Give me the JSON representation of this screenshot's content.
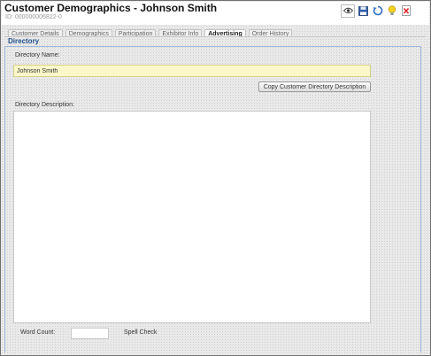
{
  "header": {
    "title": "Customer Demographics - Johnson Smith",
    "subtitle": "ID: 000000006822-0"
  },
  "toolbar": {
    "icons": [
      "eye-icon",
      "save-icon",
      "refresh-icon",
      "lightbulb-icon",
      "delete-icon"
    ]
  },
  "tabs": [
    {
      "label": "Customer Details",
      "active": false
    },
    {
      "label": "Demographics",
      "active": false
    },
    {
      "label": "Participation",
      "active": false
    },
    {
      "label": "Exhibitor Info",
      "active": false
    },
    {
      "label": "Advertising",
      "active": true
    },
    {
      "label": "Order History",
      "active": false
    }
  ],
  "section": {
    "title": "Directory"
  },
  "form": {
    "directory_name_label": "Directory Name:",
    "directory_name_value": "Johnson Smith",
    "copy_button_label": "Copy Customer Directory Description",
    "directory_description_label": "Directory Description:",
    "directory_description_value": "",
    "word_count_label": "Word Count:",
    "word_count_value": "",
    "spell_check_label": "Spell Check"
  },
  "colors": {
    "section_title": "#1f4e8c",
    "input_highlight": "#fbf7c9"
  }
}
